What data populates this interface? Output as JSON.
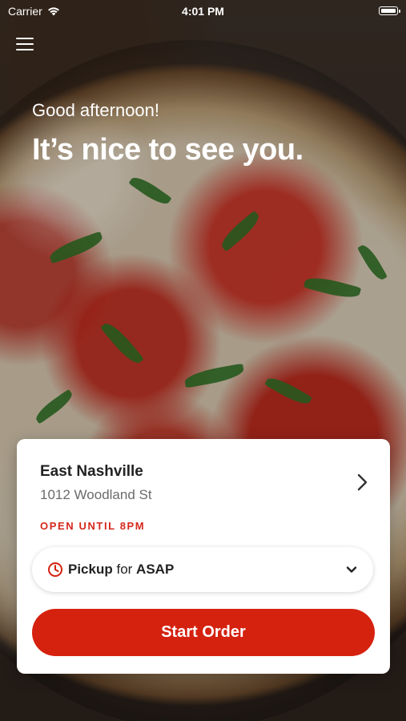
{
  "status_bar": {
    "carrier": "Carrier",
    "time": "4:01 PM",
    "wifi_icon": "wifi-icon",
    "battery_icon": "battery-icon"
  },
  "nav": {
    "menu_icon": "hamburger-menu-icon"
  },
  "hero": {
    "greeting": "Good afternoon!",
    "headline": "It’s nice to see you."
  },
  "location_card": {
    "name": "East Nashville",
    "address": "1012 Woodland St",
    "status": "OPEN UNTIL 8PM",
    "chevron_icon": "chevron-right-icon",
    "pickup": {
      "clock_icon": "clock-icon",
      "mode": "Pickup",
      "connector": " for ",
      "time": "ASAP",
      "caret_icon": "chevron-down-icon"
    },
    "start_button": "Start Order"
  },
  "colors": {
    "accent_red": "#d5220f",
    "status_red": "#d5281d",
    "card_bg": "#ffffff"
  }
}
